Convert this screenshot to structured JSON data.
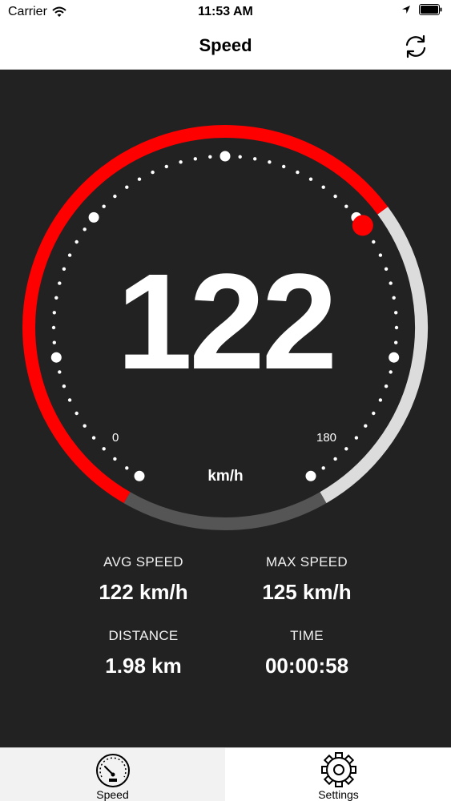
{
  "status_bar": {
    "carrier": "Carrier",
    "time": "11:53 AM",
    "wifi_icon": "wifi-icon",
    "location_icon": "location-arrow-icon",
    "battery_icon": "battery-icon"
  },
  "nav": {
    "title": "Speed",
    "refresh_icon": "refresh-icon"
  },
  "speedometer": {
    "current_speed": "122",
    "unit": "km/h",
    "scale_min": "0",
    "scale_max": "180",
    "speed_fraction": 0.678,
    "accent_color": "#ff0000",
    "track_color": "#dcdcdc",
    "bottom_arc_color": "#555555"
  },
  "stats": {
    "avg_speed": {
      "label": "AVG SPEED",
      "value": "122 km/h"
    },
    "max_speed": {
      "label": "MAX SPEED",
      "value": "125 km/h"
    },
    "distance": {
      "label": "DISTANCE",
      "value": "1.98 km"
    },
    "time": {
      "label": "TIME",
      "value": "00:00:58"
    }
  },
  "tabs": [
    {
      "label": "Speed",
      "icon": "speedometer-icon",
      "selected": true
    },
    {
      "label": "Settings",
      "icon": "gear-icon",
      "selected": false
    }
  ],
  "colors": {
    "background": "#232222",
    "accent": "#ff0000"
  }
}
